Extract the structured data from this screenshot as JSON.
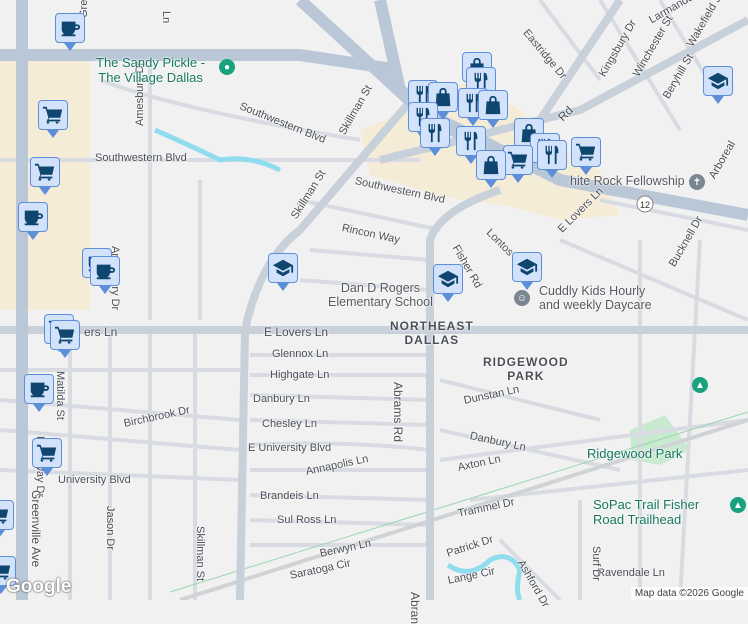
{
  "map": {
    "colors": {
      "background": "#f2f1f1",
      "commercial": "#f5ecd7",
      "park": "#c9ead0",
      "water": "#8fdcef",
      "highway": "#b9c7d7",
      "marker_fill": "#d3e2fb",
      "marker_border": "#5d8fd9",
      "icon": "#0e4670"
    },
    "streets": {
      "skillman_st_top": "Skillman St",
      "skillman_st_mid": "Skillman St",
      "skillman_st_bottom": "Skillman St",
      "southwestern_blvd_1": "Southwestern Blvd",
      "southwestern_blvd_2": "Southwestern Blvd",
      "southwestern_blvd_3": "Southwestern Blvd",
      "rincon_way": "Rincon Way",
      "amesbury_dr_1": "Amesbury Dr",
      "amesbury_dr_2": "Amesbury Dr",
      "e_lovers_ln": "E Lovers Ln",
      "lovers_ln_left": "ers Ln",
      "e_lovers_ln_right": "E Lovers Ln",
      "glennox_ln": "Glennox Ln",
      "highgate_ln": "Highgate Ln",
      "danbury_ln": "Danbury Ln",
      "danbury_ln_2": "Danbury Ln",
      "chesley_ln": "Chesley Ln",
      "e_university_blvd": "E University Blvd",
      "university_blvd": "University Blvd",
      "annapolis_ln": "Annapolis Ln",
      "brandeis_ln": "Brandeis Ln",
      "sul_ross_ln": "Sul Ross Ln",
      "berwyn_ln": "Berwyn Ln",
      "saratoga_cir": "Saratoga Cir",
      "lange_cir": "Lange Cir",
      "patrick_dr": "Patrick Dr",
      "ashford_dr": "Ashford Dr",
      "ravendale_ln": "Ravendale Ln",
      "surf_dr": "Surf Dr",
      "trammel_dr": "Trammel Dr",
      "axton_ln": "Axton Ln",
      "dunstan_ln": "Dunstan Ln",
      "abrams_rd": "Abrams Rd",
      "abrams_rd_bottom": "Abran",
      "fisher_rd": "Fisher Rd",
      "lontos_dr": "Lontos Dr",
      "e_lovers_ln_ne": "E Lovers Ln",
      "bucknell_dr": "Bucknell Dr",
      "arboreal": "Arboreal",
      "kingsbury_dr": "Kingsbury Dr",
      "winchester_st": "Winchester St",
      "beryhill_st": "Beryhill St",
      "wakefield_st": "Wakefield St",
      "larmanda_st": "Larmanda St",
      "eastridge_dr": "Eastridge Dr",
      "birchbrook_dr": "Birchbrook Dr",
      "northway_dr": "Northway Dr",
      "matilda_st": "Matilda St",
      "jason_dr": "Jason Dr",
      "greenville_ave": "Greenville Ave",
      "greenville_ave_top": "Gree",
      "rd_label": "Rd",
      "ln_top": "Ln",
      "highway_12": "12"
    },
    "places": {
      "sandy_pickle": "The Sandy Pickle -\nThe Village Dallas",
      "white_rock_fellowship": "hite Rock Fellowship",
      "dan_d_rogers": "Dan D Rogers\nElementary School",
      "cuddly_kids": "Cuddly Kids Hourly\nand weekly Daycare",
      "northeast_dallas": "NORTHEAST\nDALLAS",
      "ridgewood_park_area": "RIDGEWOOD\nPARK",
      "ridgewood_park": "Ridgewood Park",
      "sopac_trail": "SoPac Trail Fisher\nRoad Trailhead"
    },
    "attribution": {
      "logo": "Google",
      "data": "Map data ©2026 Google"
    }
  }
}
